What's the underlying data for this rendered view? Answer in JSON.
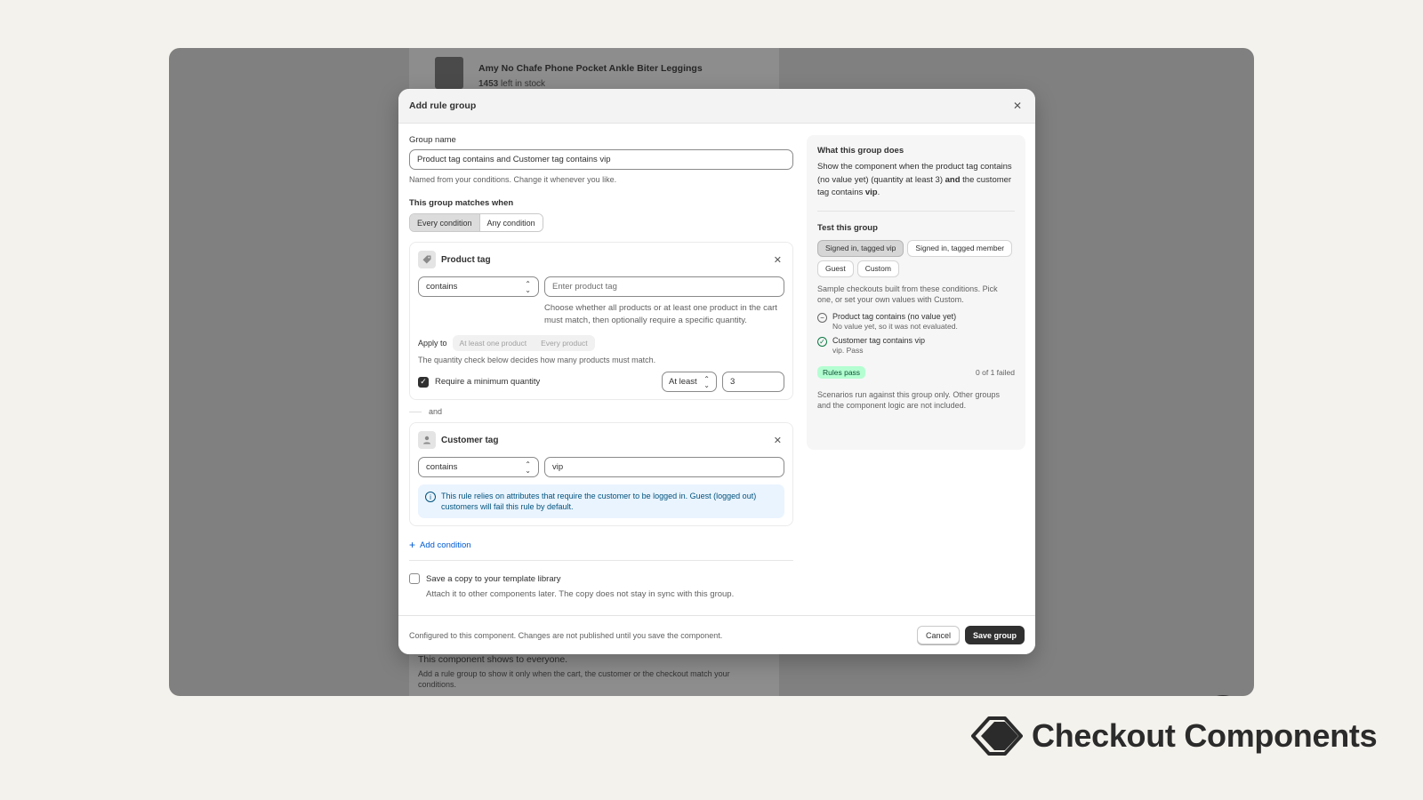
{
  "background": {
    "product_title": "Amy No Chafe Phone Pocket Ankle Biter Leggings",
    "stock_count": "1453",
    "stock_suffix": "left in stock",
    "shows_everyone": "This component shows to everyone.",
    "rule_hint": "Add a rule group to show it only when the cart, the customer or the checkout match your conditions."
  },
  "modal": {
    "title": "Add rule group",
    "group_name_label": "Group name",
    "group_name_value": "Product tag contains and Customer tag contains vip",
    "group_name_hint": "Named from your conditions. Change it whenever you like.",
    "matches_label": "This group matches when",
    "match_options": [
      "Every condition",
      "Any condition"
    ],
    "conditions": {
      "product": {
        "title": "Product tag",
        "operator": "contains",
        "placeholder": "Enter product tag",
        "help": "Choose whether all products or at least one product in the cart must match, then optionally require a specific quantity.",
        "apply_to_label": "Apply to",
        "apply_options": [
          "At least one product",
          "Every product"
        ],
        "quantity_hint": "The quantity check below decides how many products must match.",
        "min_qty_label": "Require a minimum quantity",
        "min_qty_checked": true,
        "qty_operator": "At least",
        "qty_value": "3"
      },
      "joiner": "and",
      "customer": {
        "title": "Customer tag",
        "operator": "contains",
        "value": "vip",
        "notice": "This rule relies on attributes that require the customer to be logged in. Guest (logged out) customers will fail this rule by default."
      }
    },
    "add_condition": "Add condition",
    "save_copy_label": "Save a copy to your template library",
    "save_copy_hint": "Attach it to other components later. The copy does not stay in sync with this group.",
    "footer_note": "Configured to this component. Changes are not published until you save the component.",
    "cancel": "Cancel",
    "save": "Save group"
  },
  "summary": {
    "heading": "What this group does",
    "text_start": "Show the component when the product tag contains (no value yet) (quantity at least 3)",
    "text_and": "and",
    "text_mid": "the customer tag contains",
    "text_vip": "vip",
    "text_end": ".",
    "test_heading": "Test this group",
    "scenarios": [
      "Signed in, tagged vip",
      "Signed in, tagged member",
      "Guest",
      "Custom"
    ],
    "selected_scenario": 0,
    "scenario_hint": "Sample checkouts built from these conditions. Pick one, or set your own values with Custom.",
    "results": [
      {
        "title": "Product tag contains (no value yet)",
        "sub": "No value yet, so it was not evaluated.",
        "status": "skipped"
      },
      {
        "title": "Customer tag contains vip",
        "sub": "vip. Pass",
        "status": "pass"
      }
    ],
    "pass_badge": "Rules pass",
    "failed_count": "0 of 1 failed",
    "footnote": "Scenarios run against this group only. Other groups and the component logic are not included."
  },
  "brand": {
    "name": "Checkout Components"
  },
  "colors": {
    "accent_link": "#005bd3",
    "primary_button": "#303030",
    "pass_badge_bg": "#b4fed2",
    "info_banner_bg": "#eaf4ff"
  }
}
